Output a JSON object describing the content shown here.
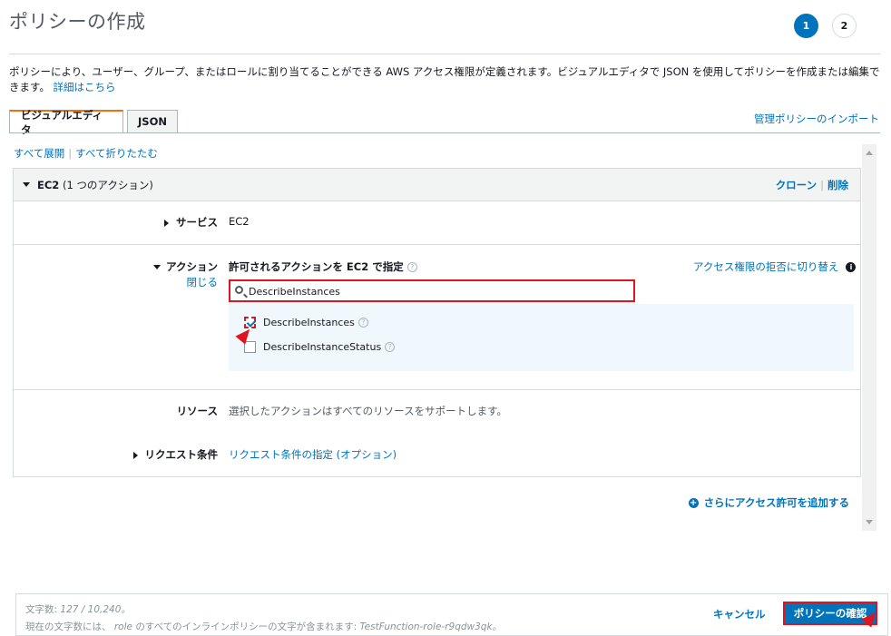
{
  "page": {
    "title": "ポリシーの作成",
    "steps": [
      "1",
      "2"
    ],
    "description_text": "ポリシーにより、ユーザー、グループ、またはロールに割り当てることができる AWS アクセス権限が定義されます。ビジュアルエディタで JSON を使用してポリシーを作成または編集できます。",
    "description_link": "詳細はこちら"
  },
  "tabs": {
    "visual": "ビジュアルエディタ",
    "json": "JSON",
    "import_link": "管理ポリシーのインポート"
  },
  "editor": {
    "expand_all": "すべて展開",
    "collapse_all": "すべて折りたたむ",
    "panel": {
      "service_name": "EC2",
      "action_count": "(1 つのアクション)",
      "clone": "クローン",
      "delete": "削除"
    },
    "service_row": {
      "label": "サービス",
      "value": "EC2"
    },
    "action_row": {
      "label": "アクション",
      "close": "閉じる",
      "heading": "許可されるアクションを EC2 で指定",
      "switch_link": "アクセス権限の拒否に切り替え",
      "search_value": "DescribeInstances",
      "options": [
        {
          "label": "DescribeInstances",
          "checked": true
        },
        {
          "label": "DescribeInstanceStatus",
          "checked": false
        }
      ]
    },
    "resource_row": {
      "label": "リソース",
      "value": "選択したアクションはすべてのリソースをサポートします。"
    },
    "request_row": {
      "label": "リクエスト条件",
      "value": "リクエスト条件の指定 (オプション)"
    },
    "add_permissions": "さらにアクセス許可を追加する"
  },
  "footer": {
    "char_count_label": "文字数:",
    "char_count_value": "127 / 10,240。",
    "note_prefix": "現在の文字数には、",
    "note_role": "role",
    "note_middle": "のすべてのインラインポリシーの文字が含まれます:",
    "note_policy": "TestFunction-role-r9qdw3qk。",
    "cancel": "キャンセル",
    "review": "ポリシーの確認"
  },
  "colors": {
    "accent": "#0073bb",
    "tab_accent": "#ec7211",
    "highlight": "#e0141e"
  }
}
